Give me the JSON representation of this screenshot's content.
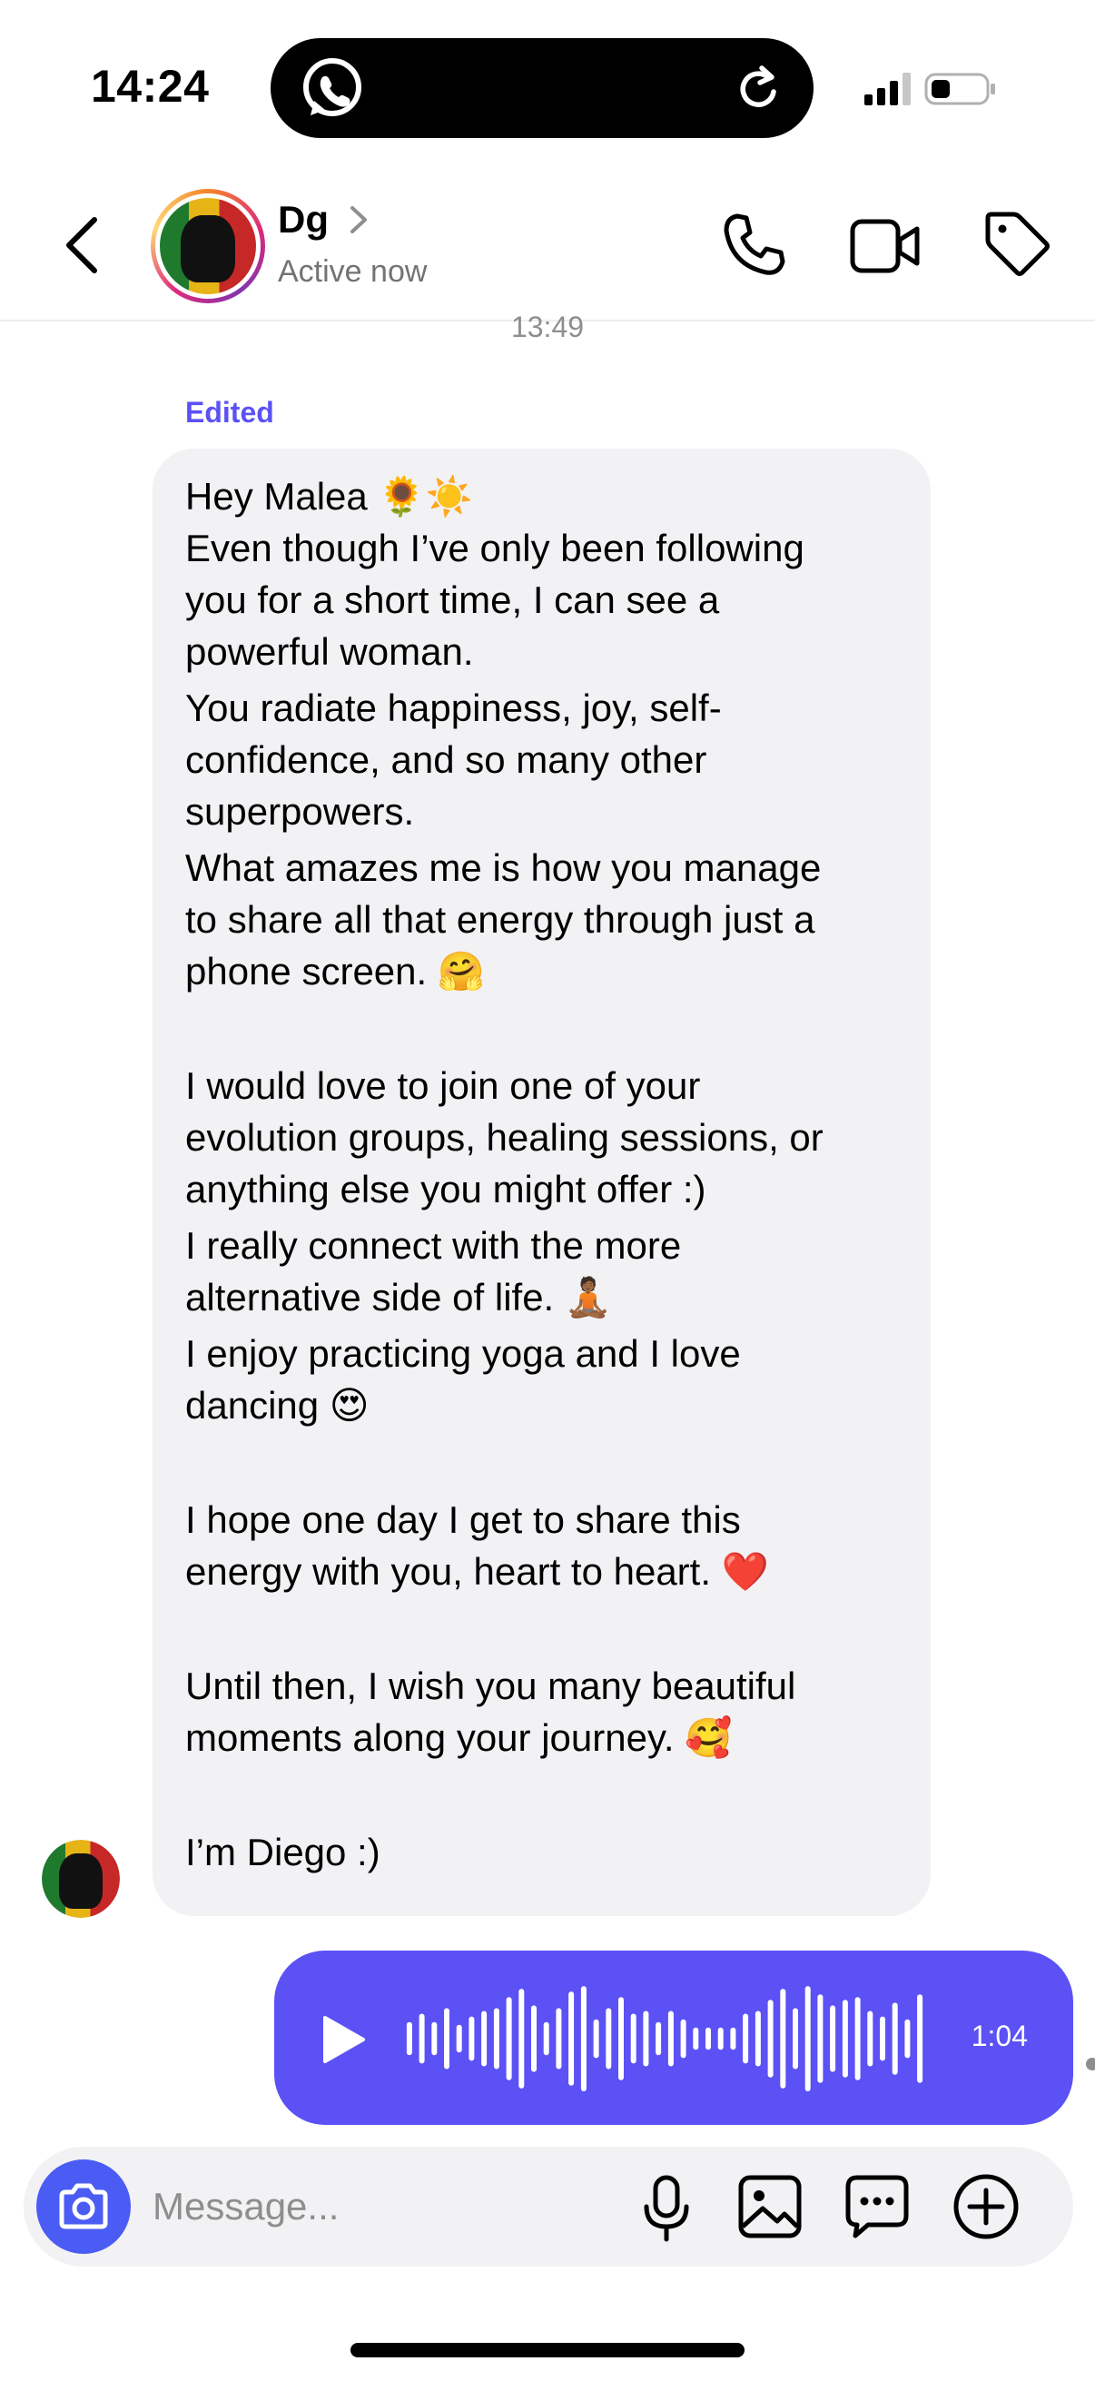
{
  "status_bar": {
    "time": "14:24",
    "island_left_icon": "whatsapp-icon",
    "island_right_icon": "refresh-icon"
  },
  "header": {
    "name": "Dg",
    "status": "Active now",
    "icons": [
      "back-chevron-icon",
      "phone-icon",
      "video-camera-icon",
      "tag-icon"
    ]
  },
  "chat": {
    "timestamp": "13:49",
    "edited_label": "Edited",
    "message_lines": [
      "Hey Malea 🌻☀️",
      "Even though I’ve only been following",
      "you for a short time, I can see a",
      "powerful woman.",
      "You radiate happiness, joy, self-",
      "confidence, and so many other",
      "superpowers.",
      "What amazes me is how you manage",
      "to share all that energy through just a",
      "phone screen. 🤗",
      "I would love to join one of your",
      "evolution groups, healing sessions, or",
      "anything else you might offer :)",
      "I really connect with the more",
      "alternative side of life. 🧘🏾",
      "I enjoy practicing yoga and I love",
      "dancing 😍",
      "I hope one day I get to share this",
      "energy with you, heart to heart. ❤️",
      "Until then, I wish you many beautiful",
      "moments along your journey. 🥰",
      "I’m Diego :)"
    ],
    "voice_message": {
      "duration": "1:04",
      "bar_color": "#5b51f5",
      "waveform_levels": [
        0.3,
        0.45,
        0.3,
        0.55,
        0.25,
        0.4,
        0.5,
        0.55,
        0.75,
        0.9,
        0.6,
        0.3,
        0.55,
        0.85,
        0.95,
        0.35,
        0.55,
        0.75,
        0.45,
        0.5,
        0.3,
        0.5,
        0.35,
        0.2,
        0.2,
        0.2,
        0.2,
        0.45,
        0.5,
        0.7,
        0.9,
        0.55,
        0.95,
        0.8,
        0.6,
        0.7,
        0.75,
        0.5,
        0.4,
        0.65,
        0.35,
        0.8
      ]
    }
  },
  "composer": {
    "placeholder": "Message...",
    "accent": "#4b5cf5",
    "icons": [
      "camera-icon",
      "microphone-icon",
      "image-icon",
      "sticker-icon",
      "plus-circle-icon"
    ]
  }
}
